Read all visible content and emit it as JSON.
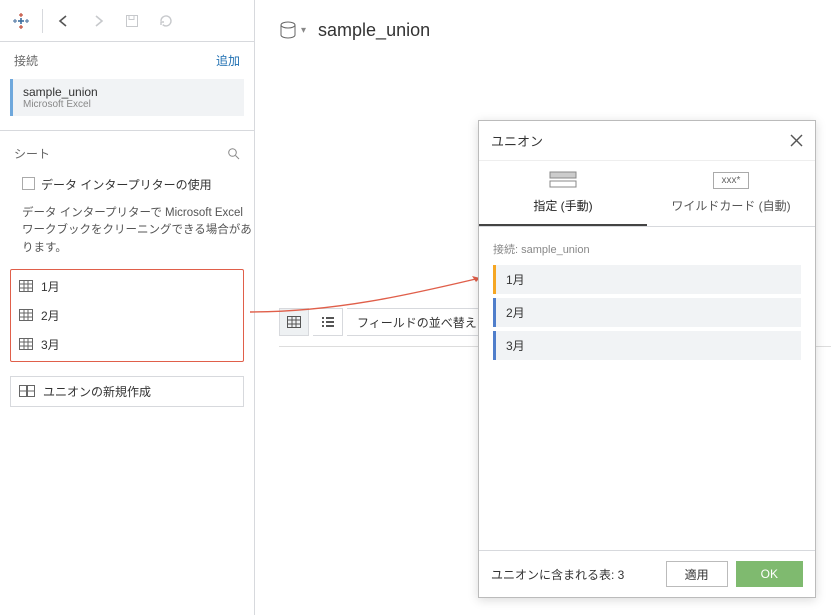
{
  "sidebar": {
    "connections_label": "接続",
    "add_label": "追加",
    "connection": {
      "name": "sample_union",
      "type": "Microsoft Excel"
    },
    "sheets_label": "シート",
    "interpreter_checkbox": "データ インタープリターの使用",
    "interpreter_help": "データ インタープリターで Microsoft Excel ワークブックをクリーニングできる場合があります。",
    "tables": [
      "1月",
      "2月",
      "3月"
    ],
    "new_union_label": "ユニオンの新規作成"
  },
  "main": {
    "datasource_name": "sample_union",
    "sort_label": "フィールドの並べ替え"
  },
  "dialog": {
    "title": "ユニオン",
    "tab_manual": "指定 (手動)",
    "tab_wildcard": "ワイルドカード (自動)",
    "wildcard_sample": "xxx*",
    "conn_label": "接続: sample_union",
    "rows": [
      "1月",
      "2月",
      "3月"
    ],
    "footer_label_prefix": "ユニオンに含まれる表: ",
    "footer_count": "3",
    "apply_label": "適用",
    "ok_label": "OK"
  }
}
